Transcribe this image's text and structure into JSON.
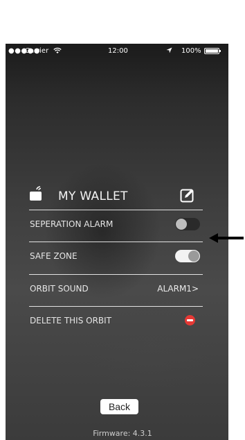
{
  "status_bar": {
    "signal": "●●●●●",
    "carrier": "Carrier",
    "wifi_icon": "wifi-icon",
    "time": "12:00",
    "location_icon": "location-arrow-icon",
    "battery": "100%"
  },
  "device": {
    "name": "MY WALLET",
    "icon": "wallet-wireless-icon",
    "edit_icon": "edit-icon"
  },
  "settings": {
    "separation_alarm": {
      "label": "SEPERATION ALARM",
      "enabled": false
    },
    "safe_zone": {
      "label": "SAFE ZONE",
      "enabled": true
    },
    "orbit_sound": {
      "label": "ORBIT SOUND",
      "value": "ALARM1>"
    },
    "delete": {
      "label": "DELETE THIS ORBIT",
      "icon": "delete-icon"
    }
  },
  "back_label": "Back",
  "firmware": "Firmware: 4.3.1",
  "colors": {
    "delete": "#e53935",
    "toggle_on": "#f3f3f3",
    "toggle_off": "#2a2a2a"
  }
}
